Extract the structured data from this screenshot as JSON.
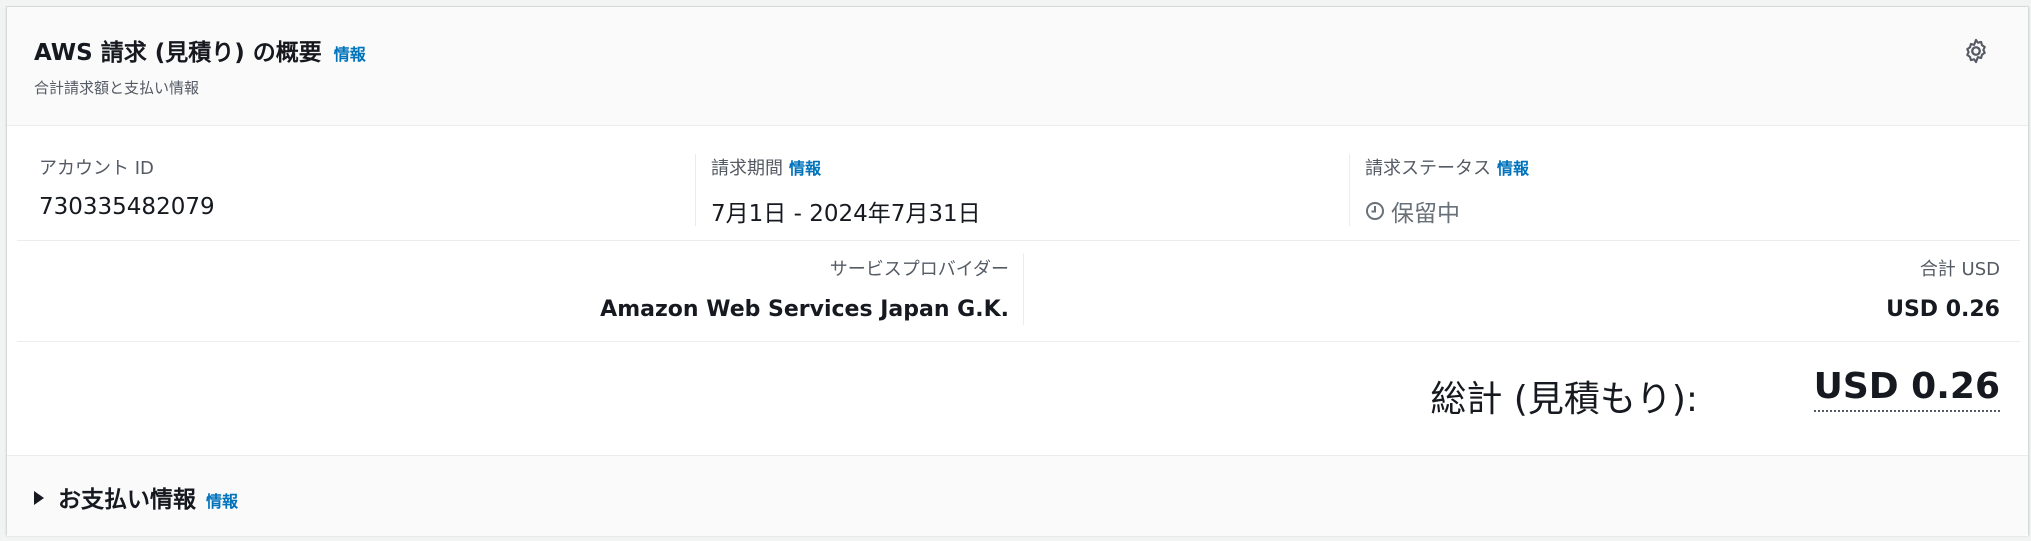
{
  "header": {
    "title": "AWS 請求 (見積り) の概要",
    "info": "情報",
    "subtitle": "合計請求額と支払い情報",
    "settings_icon": "gear-icon"
  },
  "summary": {
    "account": {
      "label": "アカウント ID",
      "value": "730335482079"
    },
    "period": {
      "label": "請求期間",
      "info": "情報",
      "value": "7月1日 - 2024年7月31日"
    },
    "status": {
      "label": "請求ステータス",
      "info": "情報",
      "value": "保留中",
      "icon": "clock-icon"
    }
  },
  "provider": {
    "label": "サービスプロバイダー",
    "value": "Amazon Web Services Japan G.K."
  },
  "total": {
    "label": "合計 USD",
    "value": "USD 0.26"
  },
  "grand_total": {
    "label": "総計 (見積もり):",
    "value": "USD 0.26"
  },
  "payment": {
    "title": "お支払い情報",
    "info": "情報"
  },
  "colors": {
    "link": "#0073bb",
    "text": "#16191f",
    "muted": "#545b64"
  }
}
